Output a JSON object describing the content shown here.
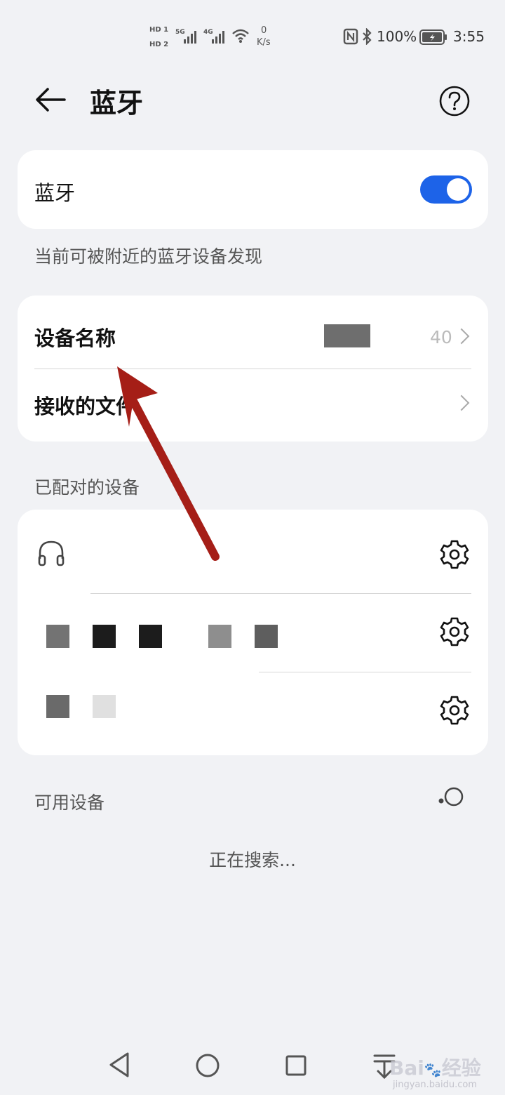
{
  "status": {
    "net_speed_value": "0",
    "net_speed_unit": "K/s",
    "battery_pct": "100%",
    "time": "3:55",
    "sim1": "HD 1",
    "sim2": "HD 2",
    "net5g": "5G",
    "net4g": "4G"
  },
  "header": {
    "title": "蓝牙",
    "back_icon": "back-arrow-icon",
    "help_icon": "help-circle-icon"
  },
  "bluetooth": {
    "label": "蓝牙",
    "enabled": true,
    "toggle_color": "#1d63e8",
    "hint": "当前可被附近的蓝牙设备发现"
  },
  "settings": {
    "device_name_label": "设备名称",
    "device_name_value": "40",
    "received_files_label": "接收的文件"
  },
  "paired": {
    "section_label": "已配对的设备",
    "devices_count": 3
  },
  "available": {
    "section_label": "可用设备",
    "searching": "正在搜索..."
  },
  "watermark": {
    "brand": "Bai",
    "brand2": "经验",
    "url": "jingyan.baidu.com"
  },
  "annotation_arrow_color": "#a51e17"
}
